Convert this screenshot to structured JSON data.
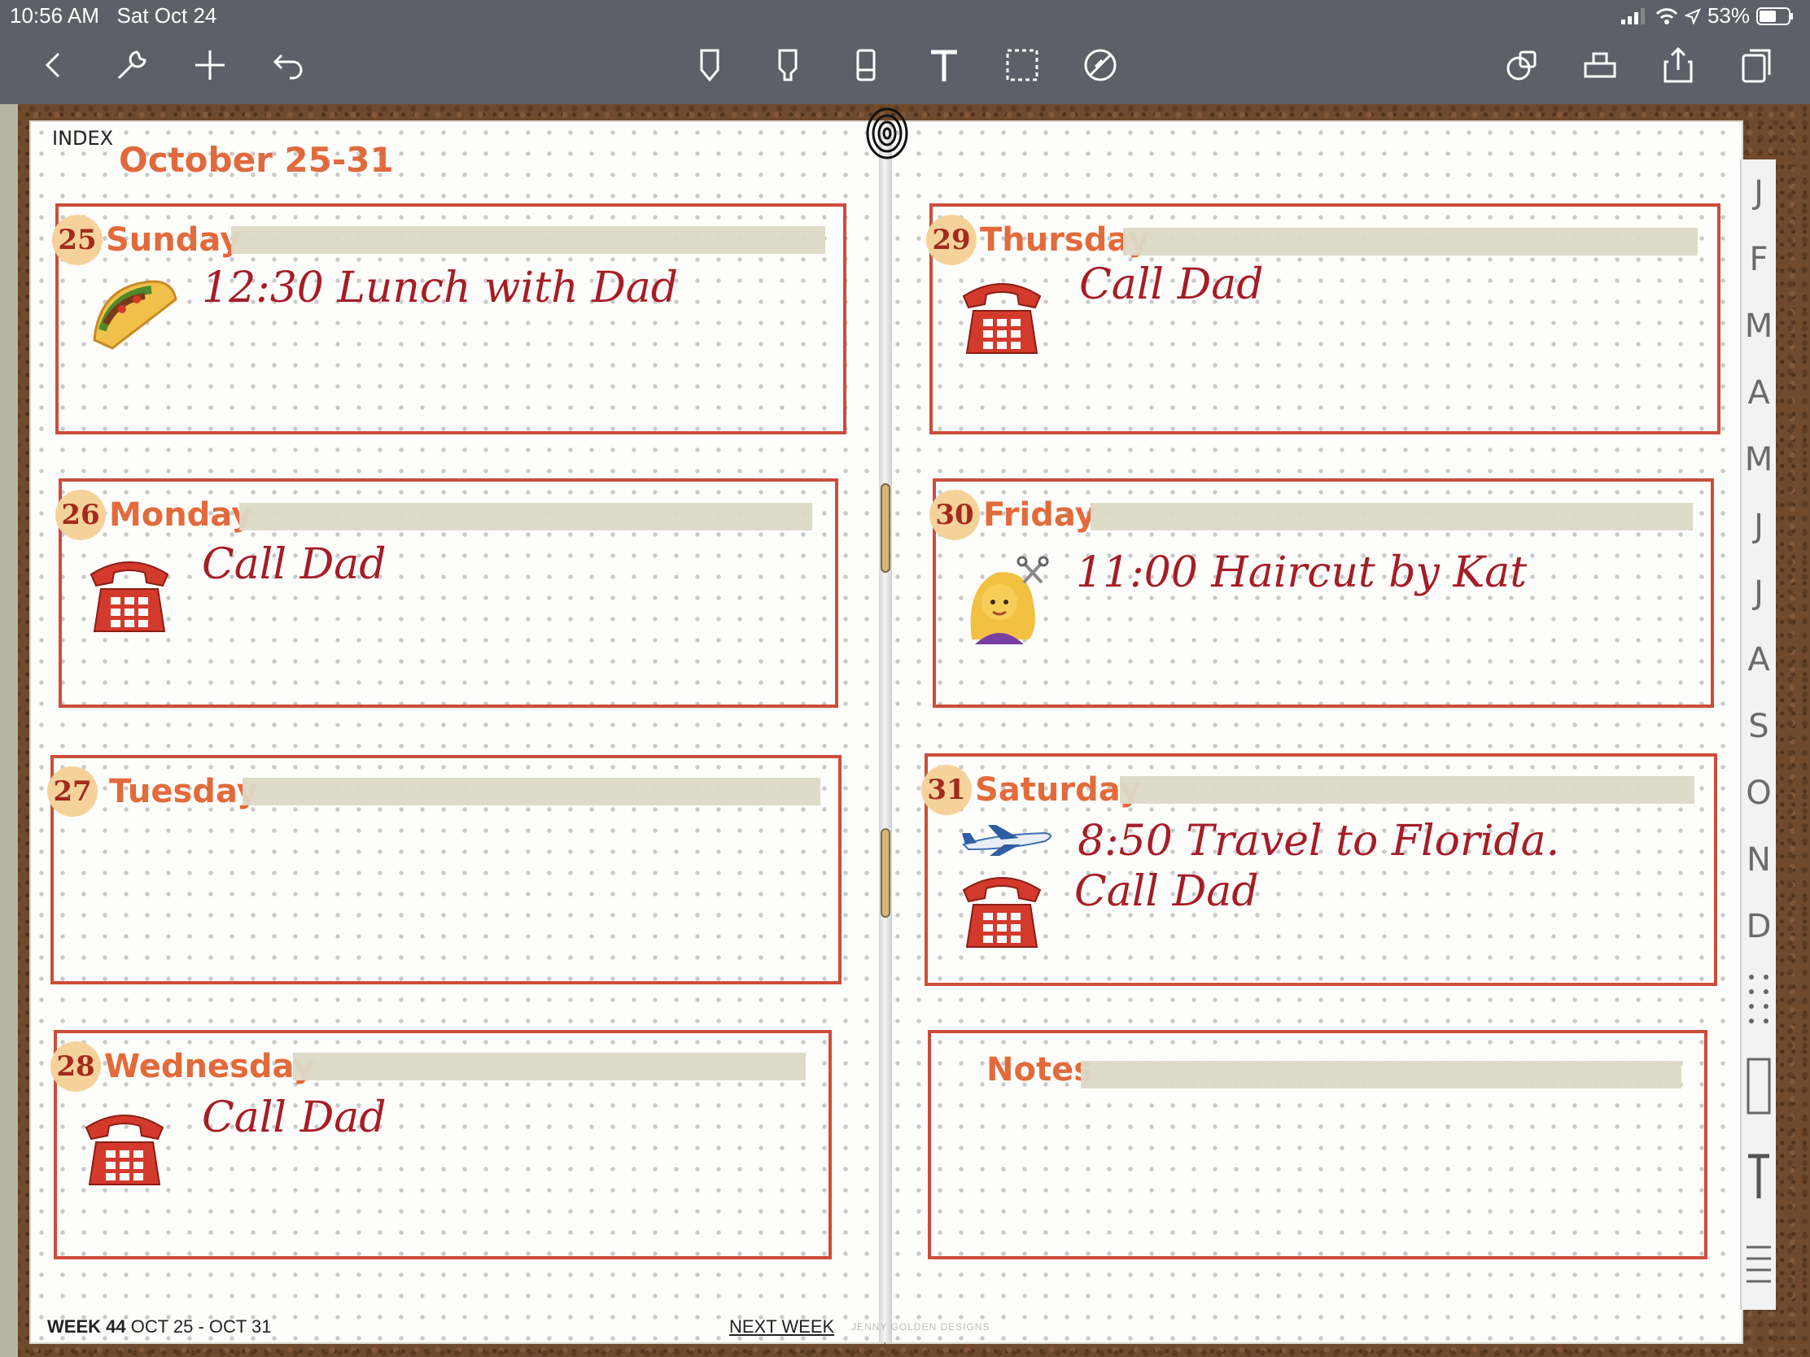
{
  "status": {
    "time": "10:56 AM",
    "date": "Sat Oct 24",
    "battery": "53%"
  },
  "toolbar": {
    "left": [
      "back-icon",
      "wrench-icon",
      "plus-icon",
      "undo-icon"
    ],
    "center": [
      "pen-icon",
      "highlighter-icon",
      "eraser-icon",
      "text-tool-icon",
      "lasso-icon",
      "laser-pointer-icon"
    ],
    "right": [
      "shapes-icon",
      "stamp-icon",
      "share-icon",
      "pages-icon"
    ]
  },
  "planner": {
    "index_label": "INDEX",
    "week_title": "October 25-31",
    "days": [
      {
        "num": "25",
        "name": "Sunday",
        "entry": "12:30  Lunch with Dad",
        "sticker": "taco-sticker"
      },
      {
        "num": "26",
        "name": "Monday",
        "entry": "Call Dad",
        "sticker": "telephone-sticker"
      },
      {
        "num": "27",
        "name": "Tuesday",
        "entry": "",
        "sticker": ""
      },
      {
        "num": "28",
        "name": "Wednesday",
        "entry": "Call Dad",
        "sticker": "telephone-sticker"
      },
      {
        "num": "29",
        "name": "Thursday",
        "entry": "Call Dad",
        "sticker": "telephone-sticker"
      },
      {
        "num": "30",
        "name": "Friday",
        "entry": "11:00  Haircut by Kat",
        "sticker": "haircut-sticker"
      },
      {
        "num": "31",
        "name": "Saturday",
        "entry": "8:50  Travel to Florida.",
        "entry2": "Call Dad",
        "sticker": "airplane-sticker"
      }
    ],
    "notes_label": "Notes",
    "footer": {
      "week_num": "WEEK 44",
      "range": "OCT 25 - OCT 31",
      "next": "NEXT WEEK",
      "brand": "JENNY GOLDEN DESIGNS"
    }
  },
  "month_tabs": [
    "J",
    "F",
    "M",
    "A",
    "M",
    "J",
    "J",
    "A",
    "S",
    "O",
    "N",
    "D"
  ],
  "colors": {
    "accent": "#e36a3b",
    "border": "#cc4d3a",
    "ink": "#a51d26",
    "tape": "#dcd9c6"
  }
}
